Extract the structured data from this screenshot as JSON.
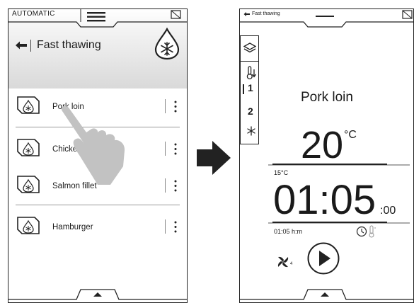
{
  "left_screen": {
    "status_label": "AUTOMATIC",
    "title": "Fast thawing",
    "items": [
      {
        "label": "Pork loin"
      },
      {
        "label": "Chicke"
      },
      {
        "label": "Salmon fillet"
      },
      {
        "label": "Hamburger"
      }
    ]
  },
  "right_screen": {
    "status_label": "Fast thawing",
    "sidebar": {
      "item1": "1",
      "item2": "2"
    },
    "recipe_name": "Pork loin",
    "temperature": {
      "value": "20",
      "unit": "°C",
      "min_label": "15°C"
    },
    "time": {
      "value": "01:05",
      "seconds": ":00",
      "unit_label": "01:05 h:m"
    },
    "fan_level": "4"
  },
  "colors": {
    "stroke": "#222222",
    "hand": "#c2c2c2",
    "divider": "#9a9a9a",
    "header_bottom": "#d9d9d9"
  }
}
